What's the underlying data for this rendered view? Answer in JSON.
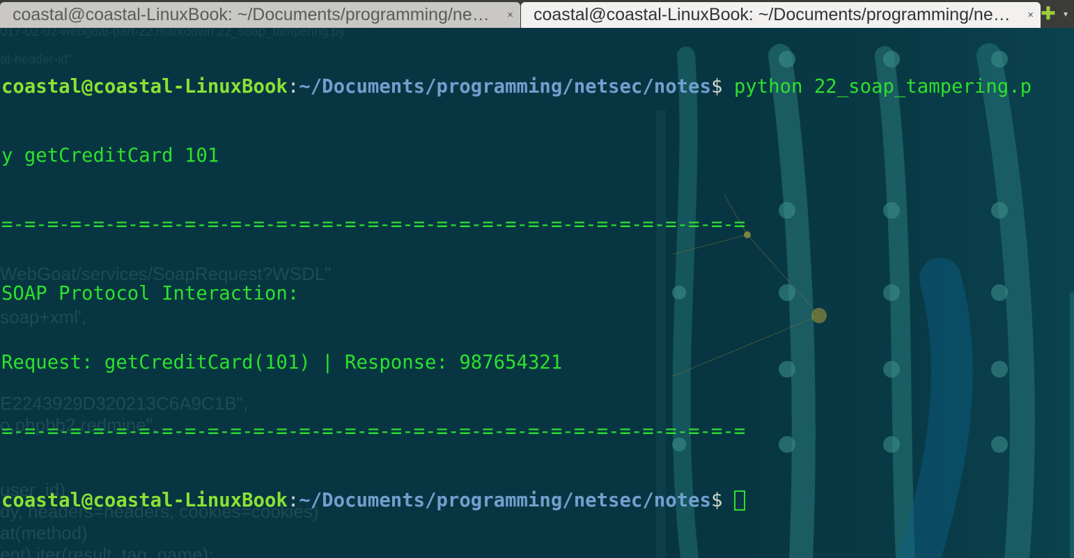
{
  "tabs": [
    {
      "title": "coastal@coastal-LinuxBook: ~/Documents/programming/netsec/notes",
      "active": false,
      "close_icon": "×"
    },
    {
      "title": "coastal@coastal-LinuxBook: ~/Documents/programming/netsec/notes",
      "active": true,
      "close_icon": "×"
    }
  ],
  "tabbar": {
    "new_tab_icon": "✚",
    "menu_icon": "▾"
  },
  "terminal": {
    "prompt": {
      "user_host": "coastal@coastal-LinuxBook",
      "sep": ":",
      "path": "~/Documents/programming/netsec/notes",
      "dollar": "$ "
    },
    "command_part1": "python 22_soap_tampering.p",
    "command_part2": "y getCreditCard 101",
    "separator": "=-=-=-=-=-=-=-=-=-=-=-=-=-=-=-=-=-=-=-=-=-=-=-=-=-=-=-=-=-=-=-=-=",
    "output_title": "SOAP Protocol Interaction:",
    "output_result": "Request: getCreditCard(101) | Response: 987654321",
    "separator2": "=-=-=-=-=-=-=-=-=-=-=-=-=-=-=-=-=-=-=-=-=-=-=-=-=-=-=-=-=-=-=-=-="
  },
  "background_ghost_text": [
    "017-02-02-webgoat-part-22.markdown    22_soap_tampering.py",
    "at-header-id\"",
    "WebGoat/services/SoapRequest?WSDL\"",
    "soap+xml',",
    "E2243929D320213C6A9C1B\",",
    "o,phpbb2,redmine\",",
    "user_id)",
    "dy, headers=headers, cookies=cookies)",
    "at(method)",
    "ent).iter(result_tag_name):"
  ],
  "colors": {
    "terminal_bg": "#073642",
    "output_green": "#2de02d",
    "prompt_user": "#8ae234",
    "prompt_path": "#729fcf"
  }
}
